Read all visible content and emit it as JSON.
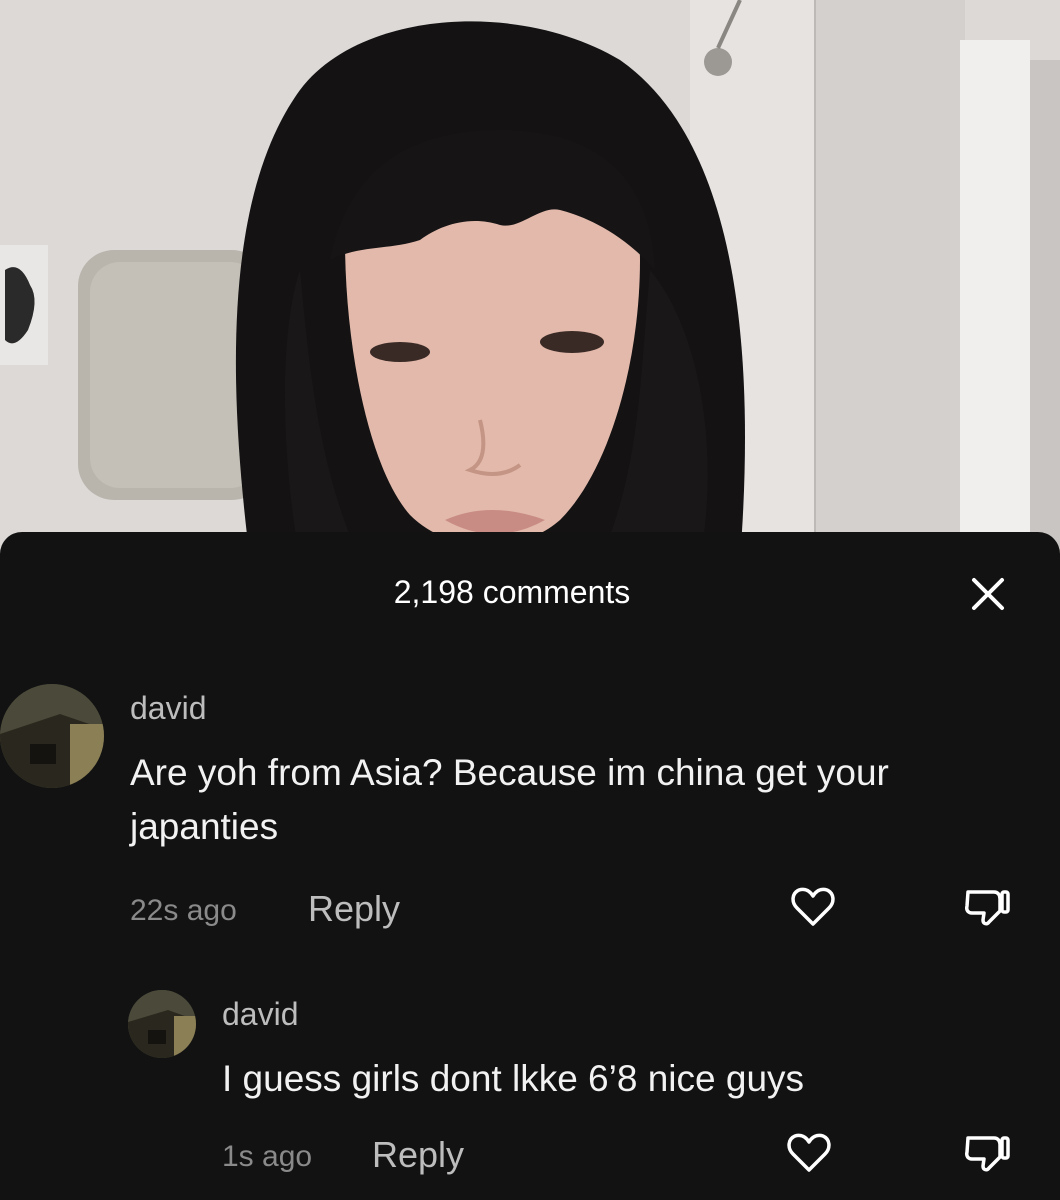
{
  "sheet": {
    "title": "2,198 comments",
    "close_icon": "close-icon"
  },
  "comments": [
    {
      "username": "david",
      "text": "Are yoh from Asia? Because im china get your japanties",
      "time": "22s ago",
      "reply_label": "Reply",
      "like_icon": "heart-outline-icon",
      "dislike_icon": "thumbs-down-icon"
    },
    {
      "username": "david",
      "text": "I guess girls dont lkke 6’8 nice guys",
      "time": "1s ago",
      "reply_label": "Reply",
      "like_icon": "heart-outline-icon",
      "dislike_icon": "thumbs-down-icon"
    }
  ],
  "colors": {
    "sheet_background": "#121212",
    "primary_text": "#f2f2f2",
    "secondary_text": "#8a8a8a"
  }
}
